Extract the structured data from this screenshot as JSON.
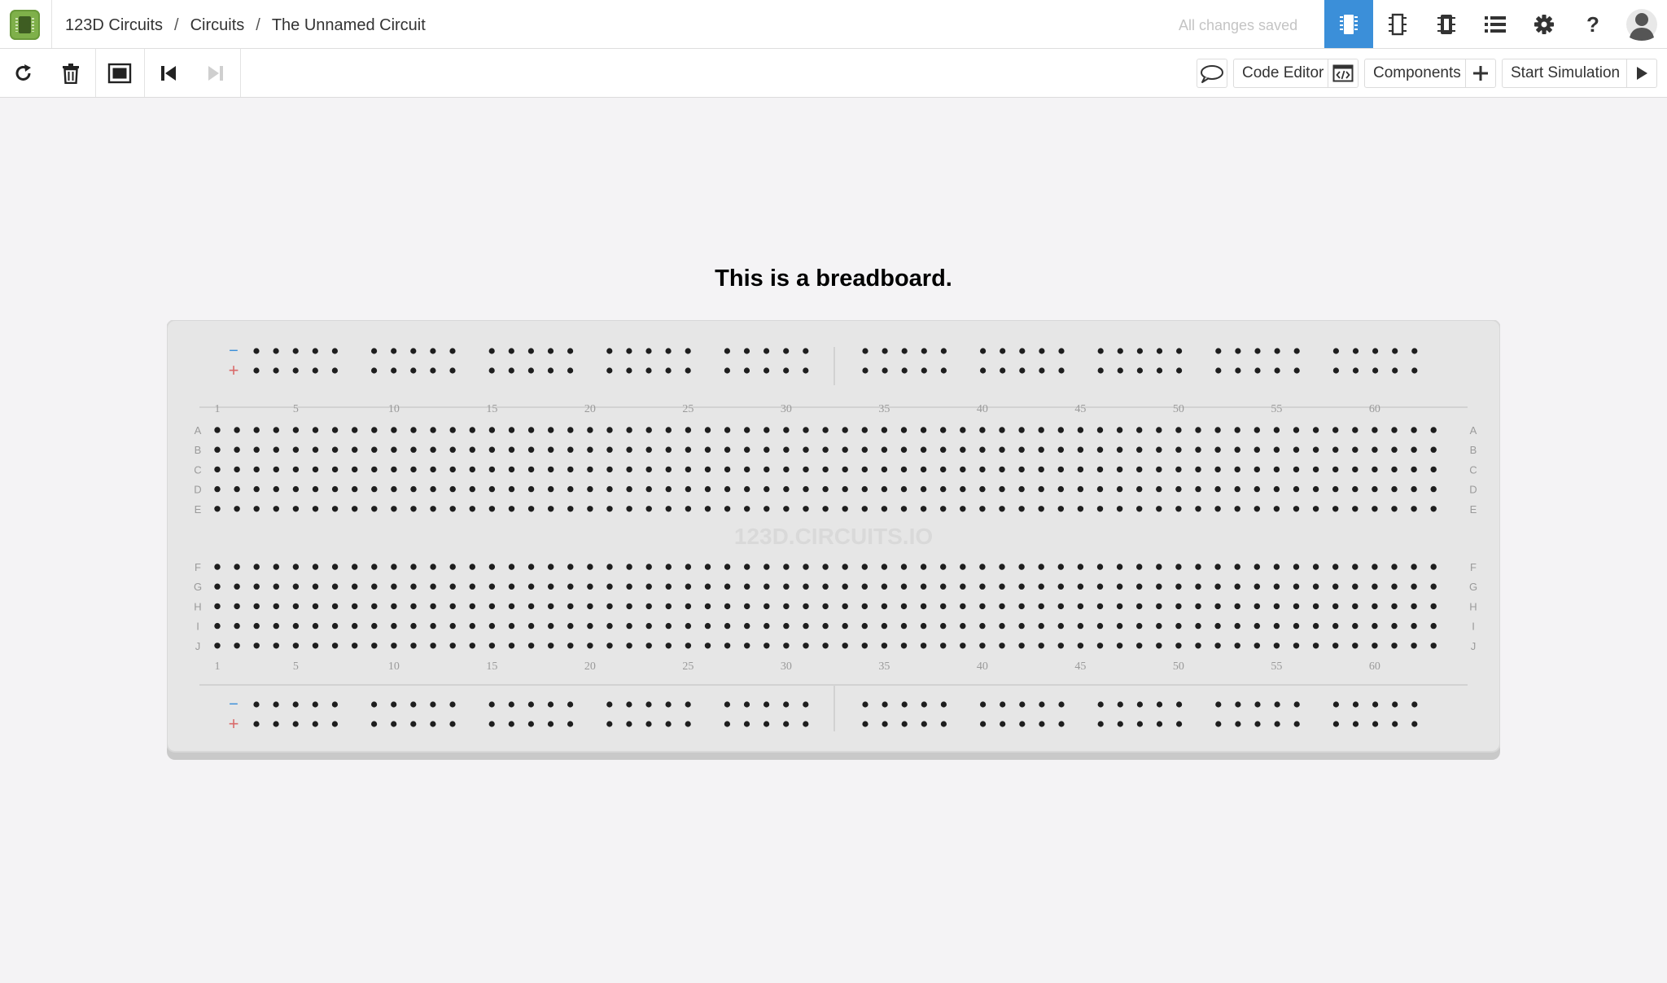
{
  "header": {
    "breadcrumbs": [
      "123D Circuits",
      "Circuits",
      "The Unnamed Circuit"
    ],
    "status": "All changes saved",
    "icons": [
      "breadboard-view-icon",
      "schematic-view-icon",
      "pcb-view-icon",
      "component-list-icon",
      "settings-icon",
      "help-icon",
      "user-avatar-icon"
    ],
    "accent_color": "#3b8fd9"
  },
  "toolbar": {
    "tools": [
      "rotate-icon",
      "delete-icon",
      "fit-to-view-icon",
      "undo-icon",
      "redo-icon"
    ],
    "comment_icon": "comment-icon",
    "code_editor_label": "Code Editor",
    "components_label": "Components",
    "start_simulation_label": "Start Simulation"
  },
  "canvas": {
    "title": "This is a breadboard.",
    "breadboard": {
      "watermark": "123D.CIRCUITS.IO",
      "columns": 63,
      "top_rows": [
        "A",
        "B",
        "C",
        "D",
        "E"
      ],
      "bottom_rows": [
        "F",
        "G",
        "H",
        "I",
        "J"
      ],
      "column_labels": [
        "1",
        "5",
        "10",
        "15",
        "20",
        "25",
        "30",
        "35",
        "40",
        "45",
        "50",
        "55",
        "60"
      ],
      "rail_minus": "−",
      "rail_plus": "+",
      "rail_groups": 10,
      "rail_holes_per_group": 5,
      "colors": {
        "board": "#e6e6e6",
        "hole": "#1e1e1e",
        "minus_rail": "#3b8fd9",
        "plus_rail": "#d96a6a",
        "label": "#9a9a9a"
      }
    }
  }
}
